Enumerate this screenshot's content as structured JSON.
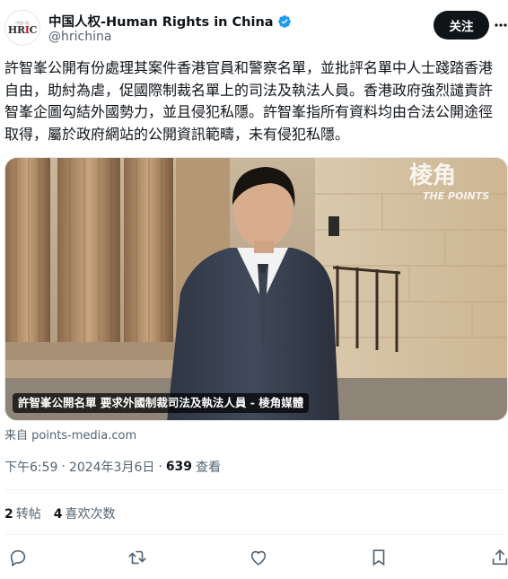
{
  "account": {
    "display_name": "中国人权-Human Rights in China",
    "handle": "@hrichina",
    "avatar_small_text": "中国人权",
    "avatar_logo": "HRIC",
    "verified_icon": "verified-badge-icon"
  },
  "header": {
    "follow_label": "关注",
    "more_icon": "more-icon"
  },
  "tweet": {
    "text": "許智峯公開有份處理其案件香港官員和警察名單，並批評名單中人士踐踏香港自由，助紂為虐，促國際制裁名單上的司法及執法人員。香港政府強烈譴責許智峯企圖勾結外國勢力，並且侵犯私隱。許智峯指所有資料均由合法公開途徑取得，屬於政府網站的公開資訊範疇，未有侵犯私隱。"
  },
  "media": {
    "caption": "許智峯公開名單 要求外國制裁司法及執法人員 - 棱角媒體",
    "source": "来自 points-media.com",
    "sign_chinese": "棱角",
    "sign_english": "THE POINTS"
  },
  "meta": {
    "time": "下午6:59",
    "separator": "·",
    "date": "2024年3月6日",
    "views_count": "639",
    "views_label": "查看"
  },
  "stats": {
    "retweets_count": "2",
    "retweets_label": "转帖",
    "likes_count": "4",
    "likes_label": "喜欢次数"
  },
  "actions": [
    "reply-icon",
    "retweet-icon",
    "like-icon",
    "bookmark-icon",
    "share-icon"
  ],
  "colors": {
    "text": "#0f1419",
    "secondary": "#536471",
    "verified": "#1d9bf0",
    "button_bg": "#0f1419"
  }
}
